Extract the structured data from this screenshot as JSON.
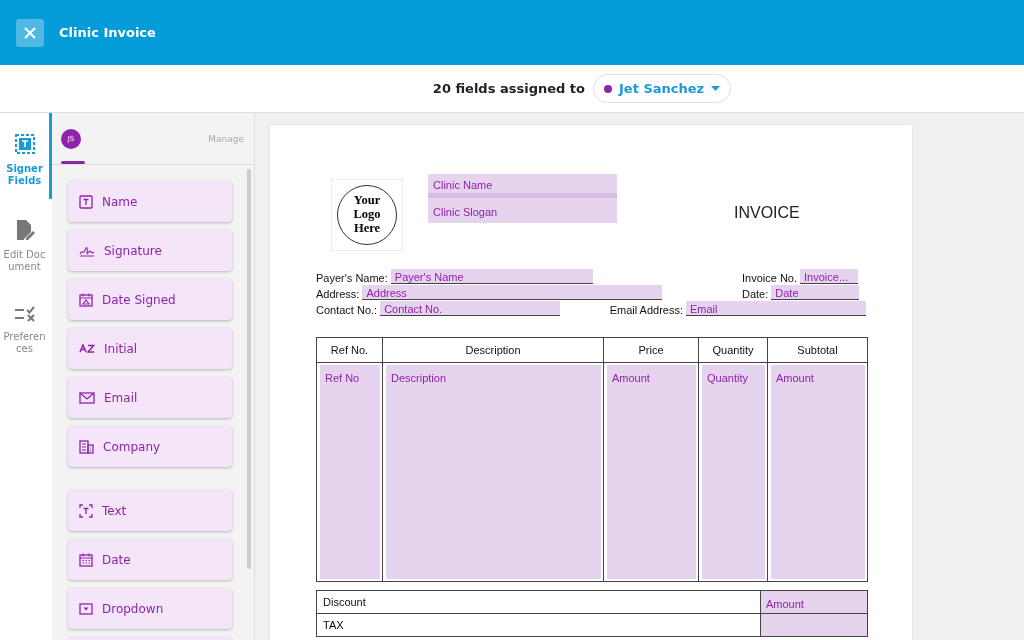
{
  "window": {
    "title": "Clinic Invoice"
  },
  "assign": {
    "text": "20 fields assigned to",
    "signer": {
      "name": "Jet Sanchez",
      "color": "#8e24aa"
    }
  },
  "nav": [
    {
      "label": "Signer Fields",
      "kind": "fields",
      "selected": true
    },
    {
      "label": "Edit Document",
      "kind": "edit",
      "selected": false
    },
    {
      "label": "Preferences",
      "kind": "prefs",
      "selected": false
    }
  ],
  "panel": {
    "avatar": "JS",
    "manage": "Manage",
    "groups": [
      [
        {
          "label": "Name",
          "kind": "name"
        },
        {
          "label": "Signature",
          "kind": "signature"
        },
        {
          "label": "Date Signed",
          "kind": "datesigned"
        },
        {
          "label": "Initial",
          "kind": "initial"
        },
        {
          "label": "Email",
          "kind": "email"
        },
        {
          "label": "Company",
          "kind": "company"
        }
      ],
      [
        {
          "label": "Text",
          "kind": "text"
        },
        {
          "label": "Date",
          "kind": "date"
        },
        {
          "label": "Dropdown",
          "kind": "dropdown"
        }
      ]
    ]
  },
  "document": {
    "logo": "Your Logo Here",
    "clinic_fields": [
      "Clinic Name",
      "Clinic Slogan"
    ],
    "title": "INVOICE",
    "left_info": [
      {
        "label": "Payer's Name:",
        "field": "Payer's Name"
      },
      {
        "label": "Address:",
        "field": "Address"
      },
      {
        "label": "Contact No.:",
        "field": "Contact No."
      }
    ],
    "right_info": [
      {
        "label": "Invoice No.",
        "field": "Invoice..."
      },
      {
        "label": "Date:",
        "field": "Date"
      },
      {
        "label": "Email Address:",
        "field": "Email"
      }
    ],
    "columns": [
      "Ref No.",
      "Description",
      "Price",
      "Quantity",
      "Subtotal"
    ],
    "row_fields": [
      "Ref No",
      "Description",
      "Amount",
      "Quantity",
      "Amount"
    ],
    "totals": [
      {
        "label": "Discount",
        "field": "Amount"
      },
      {
        "label": "TAX"
      }
    ]
  }
}
